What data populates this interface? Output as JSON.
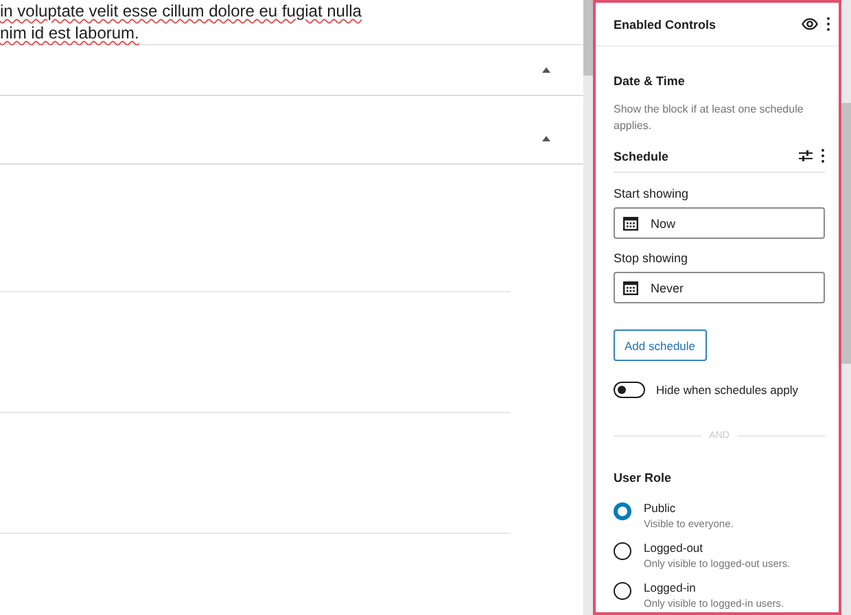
{
  "editor": {
    "paragraph_lines": [
      "in voluptate velit esse cillum dolore eu fugiat nulla",
      "nim id est laborum."
    ],
    "panels": [
      {
        "expanded": true
      },
      {
        "expanded": true
      }
    ]
  },
  "sidebar": {
    "title": "Enabled Controls",
    "section_title": "Date & Time",
    "description": "Show the block if at least one schedule applies.",
    "schedule": {
      "title": "Schedule",
      "start_label": "Start showing",
      "start_value": "Now",
      "stop_label": "Stop showing",
      "stop_value": "Never"
    },
    "add_button": "Add schedule",
    "toggle": {
      "label": "Hide when schedules apply",
      "on": false
    },
    "separator": "AND",
    "user_role": {
      "title": "User Role",
      "options": [
        {
          "label": "Public",
          "description": "Visible to everyone.",
          "selected": true
        },
        {
          "label": "Logged-out",
          "description": "Only visible to logged-out users.",
          "selected": false
        },
        {
          "label": "Logged-in",
          "description": "Only visible to logged-in users.",
          "selected": false
        }
      ]
    }
  }
}
